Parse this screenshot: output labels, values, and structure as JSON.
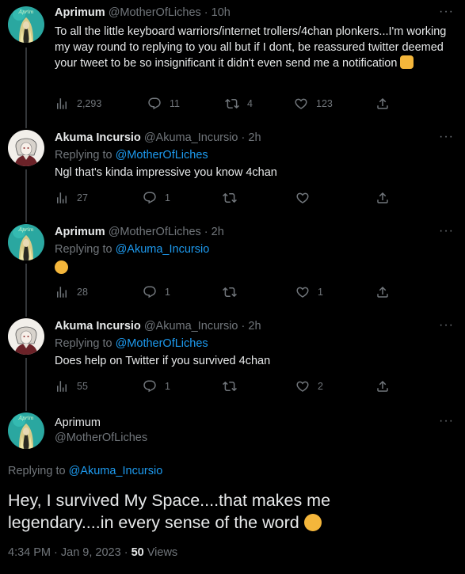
{
  "tweets": [
    {
      "name": "Aprimum",
      "handle": "@MotherOfLiches",
      "sep": "·",
      "time": "10h",
      "text": "To all the little keyboard warriors/internet trollers/4chan plonkers...I'm working my way round to replying to you all but if I dont, be reassured twitter deemed your tweet to be so insignificant it didn't even send me a notification",
      "views": "2,293",
      "replies": "11",
      "retweets": "4",
      "likes": "123"
    },
    {
      "name": "Akuma Incursio",
      "handle": "@Akuma_Incursio",
      "sep": "·",
      "time": "2h",
      "replying_prefix": "Replying to",
      "replying_to": "@MotherOfLiches",
      "text": "Ngl that's kinda impressive you know 4chan",
      "views": "27",
      "replies": "1",
      "retweets": "",
      "likes": ""
    },
    {
      "name": "Aprimum",
      "handle": "@MotherOfLiches",
      "sep": "·",
      "time": "2h",
      "replying_prefix": "Replying to",
      "replying_to": "@Akuma_Incursio",
      "views": "28",
      "replies": "1",
      "retweets": "",
      "likes": "1"
    },
    {
      "name": "Akuma Incursio",
      "handle": "@Akuma_Incursio",
      "sep": "·",
      "time": "2h",
      "replying_prefix": "Replying to",
      "replying_to": "@MotherOfLiches",
      "text": "Does help on Twitter if you survived 4chan",
      "views": "55",
      "replies": "1",
      "retweets": "",
      "likes": "2"
    }
  ],
  "main": {
    "name": "Aprimum",
    "handle": "@MotherOfLiches",
    "replying_prefix": "Replying to",
    "replying_to": "@Akuma_Incursio",
    "text": "Hey, I survived My Space....that makes me legendary....in every sense of the word",
    "time": "4:34 PM · Jan 9, 2023",
    "sep": "·",
    "views_count": "50",
    "views_label": "Views"
  },
  "more_glyph": "···",
  "icons": [
    "views-icon",
    "reply-icon",
    "retweet-icon",
    "like-icon",
    "share-icon",
    "more-icon",
    "emoji-icon"
  ],
  "colors": {
    "background": "#000000",
    "text": "#e7e9ea",
    "muted": "#71767b",
    "link": "#1d9bf0",
    "line": "#333639"
  }
}
